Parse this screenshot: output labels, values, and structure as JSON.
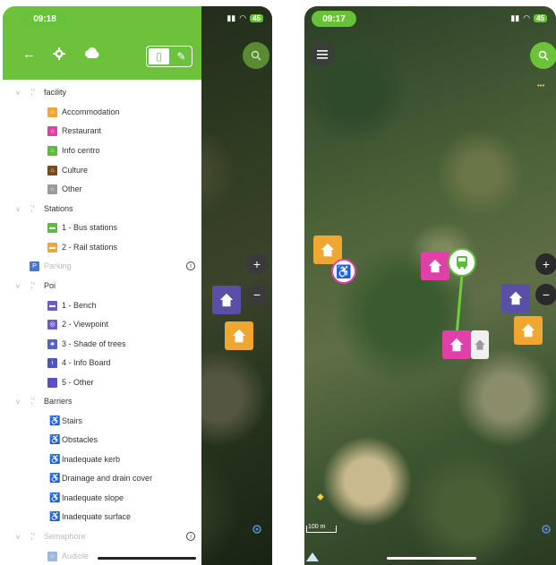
{
  "left_screen": {
    "status": {
      "time": "09:18",
      "battery": "45"
    },
    "legend": [
      {
        "type": "group",
        "label": "facility"
      },
      {
        "type": "item",
        "label": "Accommodation",
        "color": "#f0a732",
        "glyph": "⌂"
      },
      {
        "type": "item",
        "label": "Restaurant",
        "color": "#e040a8",
        "glyph": "⌂"
      },
      {
        "type": "item",
        "label": "Info centro",
        "color": "#5cba3c",
        "glyph": "⌂"
      },
      {
        "type": "item",
        "label": "Culture",
        "color": "#7a4a1e",
        "glyph": "⌂"
      },
      {
        "type": "item",
        "label": "Other",
        "color": "#9a9a9a",
        "glyph": "⌂"
      },
      {
        "type": "group",
        "label": "Stations"
      },
      {
        "type": "item",
        "label": "1 - Bus stations",
        "color": "#5cba3c",
        "glyph": "▬"
      },
      {
        "type": "item",
        "label": "2 - Rail stations",
        "color": "#f0a732",
        "glyph": "▬"
      },
      {
        "type": "top",
        "label": "Parking",
        "color": "#4a78c8",
        "glyph": "P",
        "info": "i"
      },
      {
        "type": "group",
        "label": "Poi"
      },
      {
        "type": "item",
        "label": "1 - Bench",
        "color": "#6a5acd",
        "glyph": "▬"
      },
      {
        "type": "item",
        "label": "2 - Viewpoint",
        "color": "#6a5acd",
        "glyph": "◎"
      },
      {
        "type": "item",
        "label": "3 - Shade of trees",
        "color": "#5560c8",
        "glyph": "♣"
      },
      {
        "type": "item",
        "label": "4 - Info Board",
        "color": "#4a55c0",
        "glyph": "i"
      },
      {
        "type": "item",
        "label": "5 - Other",
        "color": "#5a4fc8",
        "glyph": ""
      },
      {
        "type": "group",
        "label": "Barriers"
      },
      {
        "type": "wheel",
        "label": "Stairs",
        "color": "#b03ad0"
      },
      {
        "type": "wheel",
        "label": "Obstacles",
        "color": "#f0a732"
      },
      {
        "type": "wheel",
        "label": "Inadequate kerb",
        "color": "#e0407a"
      },
      {
        "type": "wheel",
        "label": "Drainage and drain cover",
        "color": "#b08820"
      },
      {
        "type": "wheel",
        "label": "Inadequate slope",
        "color": "#e040c8"
      },
      {
        "type": "wheel",
        "label": "Inadequate surface",
        "color": "#c040a0"
      },
      {
        "type": "group-grey",
        "label": "Semaphore",
        "info": "i"
      },
      {
        "type": "item-grey",
        "label": "Audiole",
        "color": "#9ab8e0",
        "glyph": "⌂"
      }
    ],
    "map_controls": {
      "zoom_in": "+",
      "zoom_out": "−"
    }
  },
  "right_screen": {
    "status": {
      "time": "09:17",
      "battery": "45"
    },
    "map_controls": {
      "zoom_in": "+",
      "zoom_out": "−",
      "more": "•••"
    },
    "scale_label": "100 m",
    "colors": {
      "accent": "#6cc33b",
      "route": "#6cd03b"
    }
  }
}
